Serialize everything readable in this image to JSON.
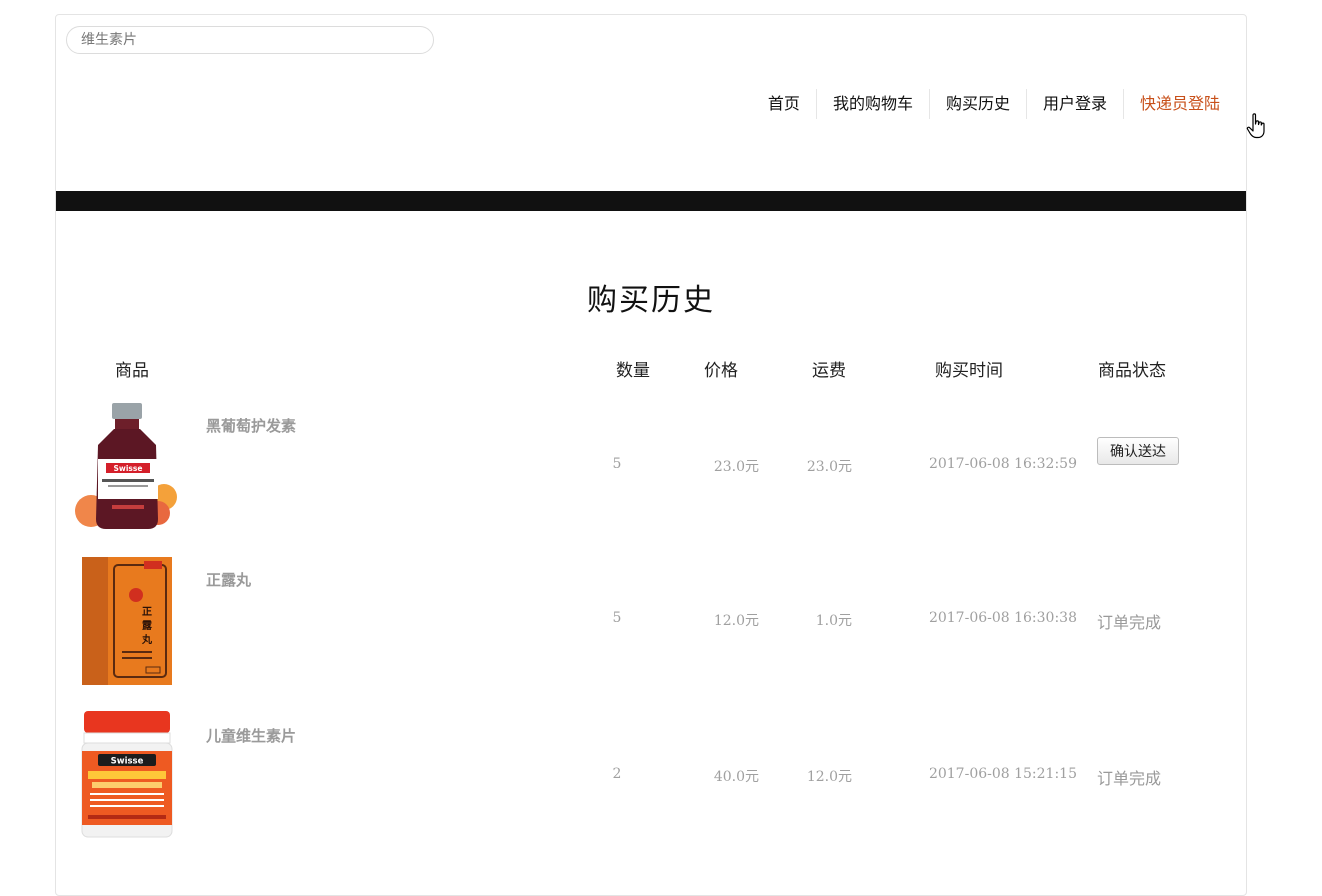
{
  "search": {
    "placeholder": "维生素片"
  },
  "nav": {
    "items": [
      {
        "label": "首页"
      },
      {
        "label": "我的购物车"
      },
      {
        "label": "购买历史"
      },
      {
        "label": "用户登录"
      },
      {
        "label": "快递员登陆"
      }
    ],
    "active_color": "#c8501a"
  },
  "page": {
    "title": "购买历史"
  },
  "table": {
    "headers": {
      "product": "商品",
      "quantity": "数量",
      "price": "价格",
      "shipping": "运费",
      "purchase_time": "购买时间",
      "status": "商品状态"
    },
    "rows": [
      {
        "name": "黑葡萄护发素",
        "quantity": "5",
        "price": "23.0元",
        "shipping": "23.0元",
        "time": "2017-06-08 16:32:59",
        "action_label": "确认送达",
        "image_icon": "hair-skin-nails-bottle",
        "image_label": "Swisse"
      },
      {
        "name": "正露丸",
        "quantity": "5",
        "price": "12.0元",
        "shipping": "1.0元",
        "time": "2017-06-08 16:30:38",
        "status": "订单完成",
        "image_icon": "zhenglu-pill-box",
        "image_label": "正露丸"
      },
      {
        "name": "儿童维生素片",
        "quantity": "2",
        "price": "40.0元",
        "shipping": "12.0元",
        "time": "2017-06-08 15:21:15",
        "status": "订单完成",
        "image_icon": "childrens-vitamin-jar",
        "image_label": "Swisse"
      }
    ]
  }
}
